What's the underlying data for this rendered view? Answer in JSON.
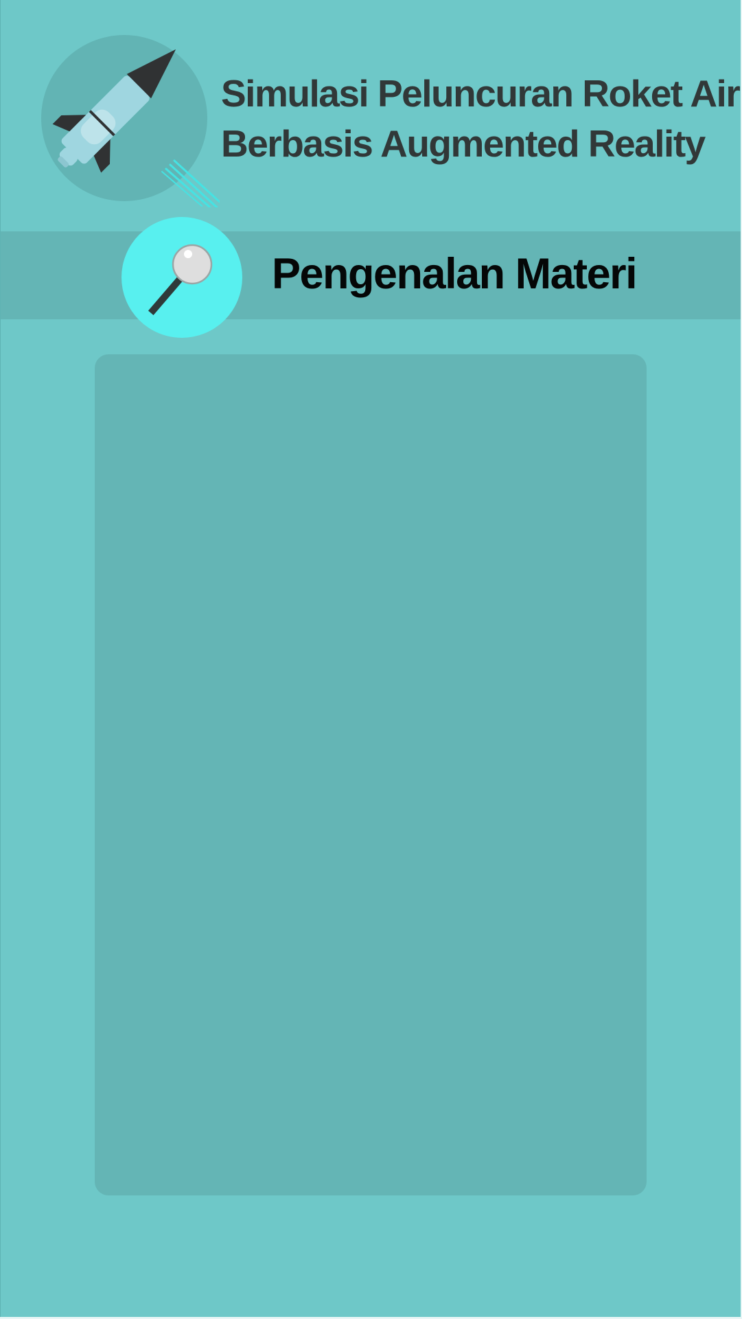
{
  "app": {
    "title_line1": "Simulasi Peluncuran Roket Air",
    "title_line2": "Berbasis Augmented Reality",
    "logo_icon": "rocket-icon"
  },
  "section": {
    "title": "Pengenalan Materi",
    "icon": "magnifier-icon"
  },
  "content_panel": {
    "text": ""
  },
  "colors": {
    "background": "#6ec8c8",
    "banner": "#64b5b5",
    "panel": "#64b5b5",
    "icon_circle": "#58f0ef",
    "title_text": "#313838",
    "section_title_text": "#050707"
  }
}
